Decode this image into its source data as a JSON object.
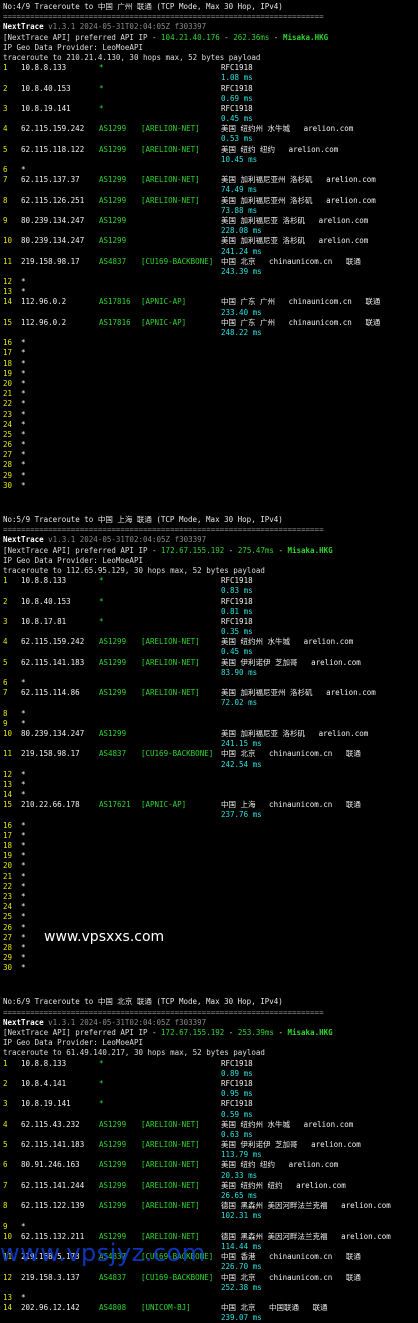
{
  "blocks": [
    {
      "title": "No:4/9 Traceroute to 中国 广州 联通 (TCP Mode, Max 30 Hop, IPv4)",
      "separator": "=======================================================================",
      "nexttrace": {
        "name": "NextTrace",
        "version": "v1.3.1 2024-05-31T02:04:05Z f303397"
      },
      "api": {
        "prefix": "[NextTrace API] preferred API IP - ",
        "ip": "104.21.40.176",
        "dash": " - ",
        "ms": "262.36ms",
        "dash2": " - ",
        "node": "Misaka.HKG"
      },
      "provider": "IP Geo Data Provider: LeoMoeAPI",
      "traceroute": "traceroute to 210.21.4.130, 30 hops max, 52 bytes payload",
      "hops": [
        {
          "hop": "1",
          "ip": "10.8.8.133",
          "as": "*",
          "tag": "",
          "geo": "RFC1918",
          "ms": "1.08 ms"
        },
        {
          "hop": "2",
          "ip": "10.8.40.153",
          "as": "*",
          "tag": "",
          "geo": "RFC1918",
          "ms": "0.69 ms"
        },
        {
          "hop": "3",
          "ip": "10.8.19.141",
          "as": "*",
          "tag": "",
          "geo": "RFC1918",
          "ms": "0.45 ms"
        },
        {
          "hop": "4",
          "ip": "62.115.159.242",
          "as": "AS1299",
          "tag": "[ARELION-NET]",
          "geo": "美国 纽约州 水牛城   arelion.com",
          "ms": "0.53 ms"
        },
        {
          "hop": "5",
          "ip": "62.115.118.122",
          "as": "AS1299",
          "tag": "[ARELION-NET]",
          "geo": "美国 纽约 纽约   arelion.com",
          "ms": "10.45 ms"
        },
        {
          "hop": "6",
          "ip": "*",
          "as": "",
          "tag": "",
          "geo": "",
          "ms": ""
        },
        {
          "hop": "7",
          "ip": "62.115.137.37",
          "as": "AS1299",
          "tag": "[ARELION-NET]",
          "geo": "美国 加利福尼亚州 洛杉矶   arelion.com",
          "ms": "74.49 ms"
        },
        {
          "hop": "8",
          "ip": "62.115.126.251",
          "as": "AS1299",
          "tag": "[ARELION-NET]",
          "geo": "美国 加利福尼亚州 洛杉矶   arelion.com",
          "ms": "73.88 ms"
        },
        {
          "hop": "9",
          "ip": "80.239.134.247",
          "as": "AS1299",
          "tag": "",
          "geo": "美国 加利福尼亚 洛杉矶   arelion.com",
          "ms": "228.08 ms"
        },
        {
          "hop": "10",
          "ip": "80.239.134.247",
          "as": "AS1299",
          "tag": "",
          "geo": "美国 加利福尼亚 洛杉矶   arelion.com",
          "ms": "241.24 ms"
        },
        {
          "hop": "11",
          "ip": "219.158.98.17",
          "as": "AS4837",
          "tag": "[CU169-BACKBONE]",
          "geo": "中国 北京   chinaunicom.cn   联通",
          "ms": "243.39 ms"
        },
        {
          "hop": "12",
          "ip": "*",
          "as": "",
          "tag": "",
          "geo": "",
          "ms": ""
        },
        {
          "hop": "13",
          "ip": "*",
          "as": "",
          "tag": "",
          "geo": "",
          "ms": ""
        },
        {
          "hop": "14",
          "ip": "112.96.0.2",
          "as": "AS17816",
          "tag": "[APNIC-AP]",
          "geo": "中国 广东 广州   chinaunicom.cn   联通",
          "ms": "233.40 ms"
        },
        {
          "hop": "15",
          "ip": "112.96.0.2",
          "as": "AS17816",
          "tag": "[APNIC-AP]",
          "geo": "中国 广东 广州   chinaunicom.cn   联通",
          "ms": "248.22 ms"
        },
        {
          "hop": "16",
          "ip": "*",
          "as": "",
          "tag": "",
          "geo": "",
          "ms": ""
        },
        {
          "hop": "17",
          "ip": "*",
          "as": "",
          "tag": "",
          "geo": "",
          "ms": ""
        },
        {
          "hop": "18",
          "ip": "*",
          "as": "",
          "tag": "",
          "geo": "",
          "ms": ""
        },
        {
          "hop": "19",
          "ip": "*",
          "as": "",
          "tag": "",
          "geo": "",
          "ms": ""
        },
        {
          "hop": "20",
          "ip": "*",
          "as": "",
          "tag": "",
          "geo": "",
          "ms": ""
        },
        {
          "hop": "21",
          "ip": "*",
          "as": "",
          "tag": "",
          "geo": "",
          "ms": ""
        },
        {
          "hop": "22",
          "ip": "*",
          "as": "",
          "tag": "",
          "geo": "",
          "ms": ""
        },
        {
          "hop": "23",
          "ip": "*",
          "as": "",
          "tag": "",
          "geo": "",
          "ms": ""
        },
        {
          "hop": "24",
          "ip": "*",
          "as": "",
          "tag": "",
          "geo": "",
          "ms": ""
        },
        {
          "hop": "25",
          "ip": "*",
          "as": "",
          "tag": "",
          "geo": "",
          "ms": ""
        },
        {
          "hop": "26",
          "ip": "*",
          "as": "",
          "tag": "",
          "geo": "",
          "ms": ""
        },
        {
          "hop": "27",
          "ip": "*",
          "as": "",
          "tag": "",
          "geo": "",
          "ms": ""
        },
        {
          "hop": "28",
          "ip": "*",
          "as": "",
          "tag": "",
          "geo": "",
          "ms": ""
        },
        {
          "hop": "29",
          "ip": "*",
          "as": "",
          "tag": "",
          "geo": "",
          "ms": ""
        },
        {
          "hop": "30",
          "ip": "*",
          "as": "",
          "tag": "",
          "geo": "",
          "ms": ""
        }
      ]
    },
    {
      "title": "No:5/9 Traceroute to 中国 上海 联通 (TCP Mode, Max 30 Hop, IPv4)",
      "separator": "=======================================================================",
      "nexttrace": {
        "name": "NextTrace",
        "version": "v1.3.1 2024-05-31T02:04:05Z f303397"
      },
      "api": {
        "prefix": "[NextTrace API] preferred API IP - ",
        "ip": "172.67.155.192",
        "dash": " - ",
        "ms": "275.47ms",
        "dash2": " - ",
        "node": "Misaka.HKG"
      },
      "provider": "IP Geo Data Provider: LeoMoeAPI",
      "traceroute": "traceroute to 112.65.95.129, 30 hops max, 52 bytes payload",
      "hops": [
        {
          "hop": "1",
          "ip": "10.8.8.133",
          "as": "*",
          "tag": "",
          "geo": "RFC1918",
          "ms": "0.83 ms"
        },
        {
          "hop": "2",
          "ip": "10.8.40.153",
          "as": "*",
          "tag": "",
          "geo": "RFC1918",
          "ms": "0.81 ms"
        },
        {
          "hop": "3",
          "ip": "10.8.17.81",
          "as": "*",
          "tag": "",
          "geo": "RFC1918",
          "ms": "0.35 ms"
        },
        {
          "hop": "4",
          "ip": "62.115.159.242",
          "as": "AS1299",
          "tag": "[ARELION-NET]",
          "geo": "美国 纽约州 水牛城   arelion.com",
          "ms": "0.45 ms"
        },
        {
          "hop": "5",
          "ip": "62.115.141.183",
          "as": "AS1299",
          "tag": "[ARELION-NET]",
          "geo": "美国 伊利诺伊 芝加哥   arelion.com",
          "ms": "83.90 ms"
        },
        {
          "hop": "6",
          "ip": "*",
          "as": "",
          "tag": "",
          "geo": "",
          "ms": ""
        },
        {
          "hop": "7",
          "ip": "62.115.114.86",
          "as": "AS1299",
          "tag": "[ARELION-NET]",
          "geo": "美国 加利福尼亚州 洛杉矶   arelion.com",
          "ms": "72.02 ms"
        },
        {
          "hop": "8",
          "ip": "*",
          "as": "",
          "tag": "",
          "geo": "",
          "ms": ""
        },
        {
          "hop": "9",
          "ip": "*",
          "as": "",
          "tag": "",
          "geo": "",
          "ms": ""
        },
        {
          "hop": "10",
          "ip": "80.239.134.247",
          "as": "AS1299",
          "tag": "",
          "geo": "美国 加利福尼亚 洛杉矶   arelion.com",
          "ms": "241.15 ms"
        },
        {
          "hop": "11",
          "ip": "219.158.98.17",
          "as": "AS4837",
          "tag": "[CU169-BACKBONE]",
          "geo": "中国 北京   chinaunicom.cn   联通",
          "ms": "242.54 ms"
        },
        {
          "hop": "12",
          "ip": "*",
          "as": "",
          "tag": "",
          "geo": "",
          "ms": ""
        },
        {
          "hop": "13",
          "ip": "*",
          "as": "",
          "tag": "",
          "geo": "",
          "ms": ""
        },
        {
          "hop": "14",
          "ip": "*",
          "as": "",
          "tag": "",
          "geo": "",
          "ms": ""
        },
        {
          "hop": "15",
          "ip": "210.22.66.178",
          "as": "AS17621",
          "tag": "[APNIC-AP]",
          "geo": "中国 上海   chinaunicom.cn   联通",
          "ms": "237.76 ms"
        },
        {
          "hop": "16",
          "ip": "*",
          "as": "",
          "tag": "",
          "geo": "",
          "ms": ""
        },
        {
          "hop": "17",
          "ip": "*",
          "as": "",
          "tag": "",
          "geo": "",
          "ms": ""
        },
        {
          "hop": "18",
          "ip": "*",
          "as": "",
          "tag": "",
          "geo": "",
          "ms": ""
        },
        {
          "hop": "19",
          "ip": "*",
          "as": "",
          "tag": "",
          "geo": "",
          "ms": ""
        },
        {
          "hop": "20",
          "ip": "*",
          "as": "",
          "tag": "",
          "geo": "",
          "ms": ""
        },
        {
          "hop": "21",
          "ip": "*",
          "as": "",
          "tag": "",
          "geo": "",
          "ms": ""
        },
        {
          "hop": "22",
          "ip": "*",
          "as": "",
          "tag": "",
          "geo": "",
          "ms": ""
        },
        {
          "hop": "23",
          "ip": "*",
          "as": "",
          "tag": "",
          "geo": "",
          "ms": ""
        },
        {
          "hop": "24",
          "ip": "*",
          "as": "",
          "tag": "",
          "geo": "",
          "ms": ""
        },
        {
          "hop": "25",
          "ip": "*",
          "as": "",
          "tag": "",
          "geo": "",
          "ms": ""
        },
        {
          "hop": "26",
          "ip": "*",
          "as": "",
          "tag": "",
          "geo": "",
          "ms": ""
        },
        {
          "hop": "27",
          "ip": "*",
          "as": "",
          "tag": "",
          "geo": "",
          "ms": ""
        },
        {
          "hop": "28",
          "ip": "*",
          "as": "",
          "tag": "",
          "geo": "",
          "ms": ""
        },
        {
          "hop": "29",
          "ip": "*",
          "as": "",
          "tag": "",
          "geo": "",
          "ms": ""
        },
        {
          "hop": "30",
          "ip": "*",
          "as": "",
          "tag": "",
          "geo": "",
          "ms": ""
        }
      ]
    },
    {
      "title": "No:6/9 Traceroute to 中国 北京 联通 (TCP Mode, Max 30 Hop, IPv4)",
      "separator": "=======================================================================",
      "nexttrace": {
        "name": "NextTrace",
        "version": "v1.3.1 2024-05-31T02:04:05Z f303397"
      },
      "api": {
        "prefix": "[NextTrace API] preferred API IP - ",
        "ip": "172.67.155.192",
        "dash": " - ",
        "ms": "253.39ms",
        "dash2": " - ",
        "node": "Misaka.HKG"
      },
      "provider": "IP Geo Data Provider: LeoMoeAPI",
      "traceroute": "traceroute to 61.49.140.217, 30 hops max, 52 bytes payload",
      "hops": [
        {
          "hop": "1",
          "ip": "10.8.8.133",
          "as": "*",
          "tag": "",
          "geo": "RFC1918",
          "ms": "0.89 ms"
        },
        {
          "hop": "2",
          "ip": "10.8.4.141",
          "as": "*",
          "tag": "",
          "geo": "RFC1918",
          "ms": "0.95 ms"
        },
        {
          "hop": "3",
          "ip": "10.8.19.141",
          "as": "*",
          "tag": "",
          "geo": "RFC1918",
          "ms": "0.59 ms"
        },
        {
          "hop": "4",
          "ip": "62.115.43.232",
          "as": "AS1299",
          "tag": "[ARELION-NET]",
          "geo": "美国 纽约州 水牛城   arelion.com",
          "ms": "0.63 ms"
        },
        {
          "hop": "5",
          "ip": "62.115.141.183",
          "as": "AS1299",
          "tag": "[ARELION-NET]",
          "geo": "美国 伊利诺伊 芝加哥   arelion.com",
          "ms": "113.79 ms"
        },
        {
          "hop": "6",
          "ip": "80.91.246.163",
          "as": "AS1299",
          "tag": "[ARELION-NET]",
          "geo": "美国 纽约 纽约   arelion.com",
          "ms": "20.33 ms"
        },
        {
          "hop": "7",
          "ip": "62.115.141.244",
          "as": "AS1299",
          "tag": "[ARELION-NET]",
          "geo": "美国 纽约州 纽约   arelion.com",
          "ms": "26.65 ms"
        },
        {
          "hop": "8",
          "ip": "62.115.122.139",
          "as": "AS1299",
          "tag": "[ARELION-NET]",
          "geo": "德国 黑森州 美因河畔法兰克福   arelion.com",
          "ms": "102.31 ms"
        },
        {
          "hop": "9",
          "ip": "*",
          "as": "",
          "tag": "",
          "geo": "",
          "ms": ""
        },
        {
          "hop": "10",
          "ip": "62.115.132.211",
          "as": "AS1299",
          "tag": "[ARELION-NET]",
          "geo": "德国 黑森州 美因河畔法兰克福   arelion.com",
          "ms": "114.44 ms"
        },
        {
          "hop": "11",
          "ip": "219.158.5.173",
          "as": "AS4837",
          "tag": "[CU169-BACKBONE]",
          "geo": "中国 香港   chinaunicom.cn   联通",
          "ms": "226.70 ms"
        },
        {
          "hop": "12",
          "ip": "219.158.3.137",
          "as": "AS4837",
          "tag": "[CU169-BACKBONE]",
          "geo": "中国 北京   chinaunicom.cn   联通",
          "ms": "252.38 ms"
        },
        {
          "hop": "13",
          "ip": "*",
          "as": "",
          "tag": "",
          "geo": "",
          "ms": ""
        },
        {
          "hop": "14",
          "ip": "202.96.12.142",
          "as": "AS4808",
          "tag": "[UNICOM-BJ]",
          "geo": "中国 北京   中国联通   联通",
          "ms": "239.07 ms"
        }
      ]
    }
  ],
  "watermark_small": "www.vpsxxs.com",
  "watermark_large": "www.vpsjyz.com"
}
